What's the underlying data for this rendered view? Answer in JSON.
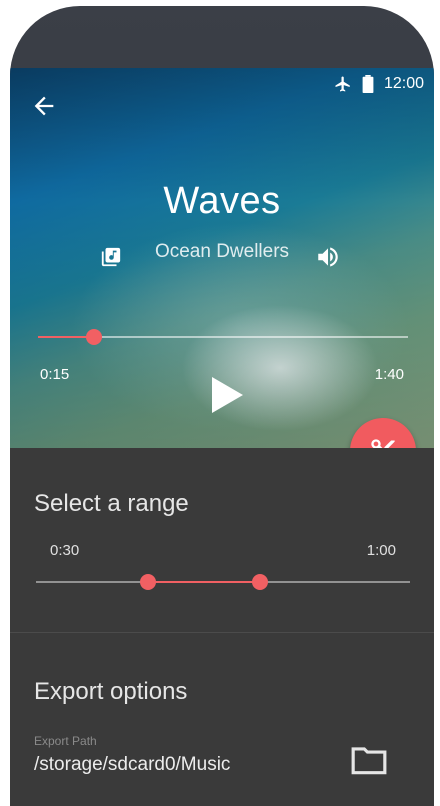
{
  "status": {
    "time": "12:00"
  },
  "player": {
    "title": "Waves",
    "artist": "Ocean Dwellers",
    "current_time": "0:15",
    "duration": "1:40",
    "progress": 0.15
  },
  "range": {
    "title": "Select a range",
    "start": "0:30",
    "end": "1:00",
    "start_fraction": 0.3,
    "end_fraction": 0.6
  },
  "export": {
    "title": "Export options",
    "path_label": "Export Path",
    "path": "/storage/sdcard0/Music"
  },
  "colors": {
    "accent": "#f15b5f",
    "panel": "#3a3a3a"
  },
  "icons": [
    "back-arrow-icon",
    "airplane-icon",
    "battery-icon",
    "queue-music-icon",
    "volume-icon",
    "play-icon",
    "scissors-icon",
    "folder-icon"
  ]
}
